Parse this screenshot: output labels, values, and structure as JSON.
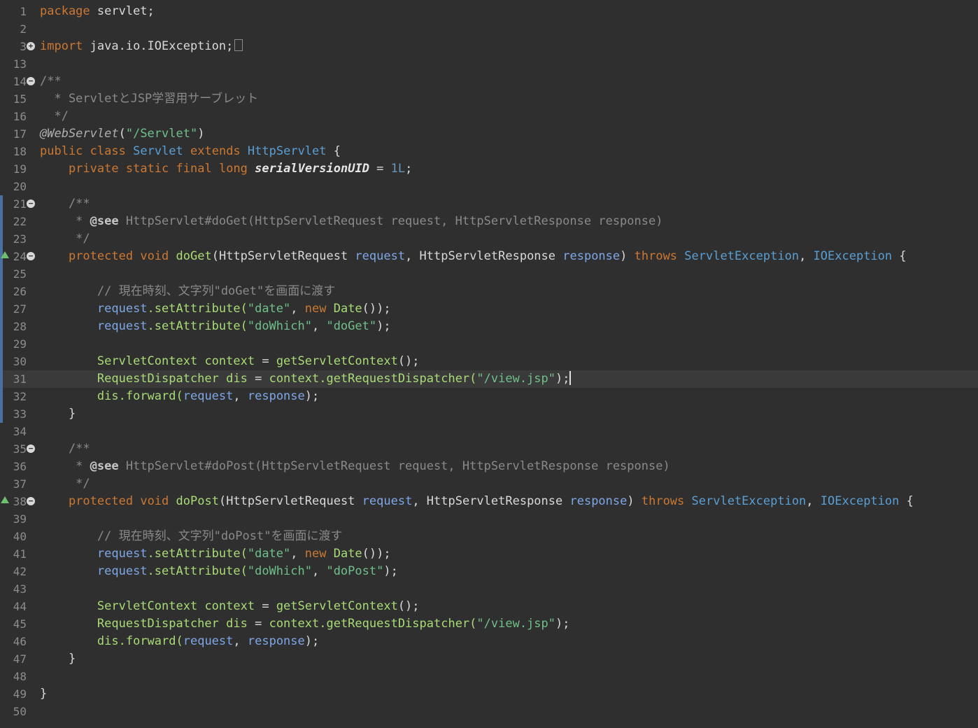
{
  "editor": {
    "language": "java",
    "current_line": 31,
    "lines": [
      {
        "n": "1",
        "marker": "",
        "tokens": [
          {
            "t": "package",
            "c": "kw"
          },
          {
            "t": " servlet;",
            "c": "plain"
          }
        ]
      },
      {
        "n": "2",
        "marker": "",
        "tokens": []
      },
      {
        "n": "3",
        "marker": "expand",
        "tokens": [
          {
            "t": "import",
            "c": "kw"
          },
          {
            "t": " java.io.IOException;",
            "c": "plain"
          }
        ],
        "collapsed": true
      },
      {
        "n": "13",
        "marker": "",
        "tokens": []
      },
      {
        "n": "14",
        "marker": "collapse",
        "tokens": [
          {
            "t": "/**",
            "c": "cmt"
          }
        ]
      },
      {
        "n": "15",
        "marker": "",
        "tokens": [
          {
            "t": "  * ServletとJSP学習用サーブレット",
            "c": "cmt"
          }
        ]
      },
      {
        "n": "16",
        "marker": "",
        "tokens": [
          {
            "t": "  */",
            "c": "cmt"
          }
        ]
      },
      {
        "n": "17",
        "marker": "",
        "tokens": [
          {
            "t": "@WebServlet",
            "c": "anno"
          },
          {
            "t": "(",
            "c": "plain"
          },
          {
            "t": "\"/Servlet\"",
            "c": "str"
          },
          {
            "t": ")",
            "c": "plain"
          }
        ]
      },
      {
        "n": "18",
        "marker": "",
        "tokens": [
          {
            "t": "public",
            "c": "kw"
          },
          {
            "t": " ",
            "c": "plain"
          },
          {
            "t": "class",
            "c": "kw"
          },
          {
            "t": " ",
            "c": "plain"
          },
          {
            "t": "Servlet",
            "c": "cls"
          },
          {
            "t": " ",
            "c": "plain"
          },
          {
            "t": "extends",
            "c": "kw"
          },
          {
            "t": " ",
            "c": "plain"
          },
          {
            "t": "HttpServlet",
            "c": "cls"
          },
          {
            "t": " {",
            "c": "plain"
          }
        ]
      },
      {
        "n": "19",
        "marker": "",
        "tokens": [
          {
            "t": "    ",
            "c": "plain"
          },
          {
            "t": "private",
            "c": "kw"
          },
          {
            "t": " ",
            "c": "plain"
          },
          {
            "t": "static",
            "c": "kw"
          },
          {
            "t": " ",
            "c": "plain"
          },
          {
            "t": "final",
            "c": "kw"
          },
          {
            "t": " ",
            "c": "plain"
          },
          {
            "t": "long",
            "c": "kw"
          },
          {
            "t": " ",
            "c": "plain"
          },
          {
            "t": "serialVersionUID",
            "c": "fieldname"
          },
          {
            "t": " = ",
            "c": "plain"
          },
          {
            "t": "1L",
            "c": "num"
          },
          {
            "t": ";",
            "c": "plain"
          }
        ]
      },
      {
        "n": "20",
        "marker": "",
        "tokens": []
      },
      {
        "n": "21",
        "marker": "collapse",
        "changed": true,
        "tokens": [
          {
            "t": "    /**",
            "c": "cmt"
          }
        ]
      },
      {
        "n": "22",
        "marker": "",
        "changed": true,
        "tokens": [
          {
            "t": "     * ",
            "c": "cmt"
          },
          {
            "t": "@see",
            "c": "tag"
          },
          {
            "t": " HttpServlet#doGet(HttpServletRequest request, HttpServletResponse response)",
            "c": "cmt"
          }
        ]
      },
      {
        "n": "23",
        "marker": "",
        "changed": true,
        "tokens": [
          {
            "t": "     */",
            "c": "cmt"
          }
        ]
      },
      {
        "n": "24",
        "marker": "collapse",
        "override": true,
        "changed": true,
        "tokens": [
          {
            "t": "    ",
            "c": "plain"
          },
          {
            "t": "protected",
            "c": "kw"
          },
          {
            "t": " ",
            "c": "plain"
          },
          {
            "t": "void",
            "c": "kw"
          },
          {
            "t": " ",
            "c": "plain"
          },
          {
            "t": "doGet",
            "c": "fld"
          },
          {
            "t": "(HttpServletRequest ",
            "c": "plain"
          },
          {
            "t": "request",
            "c": "var"
          },
          {
            "t": ", HttpServletResponse ",
            "c": "plain"
          },
          {
            "t": "response",
            "c": "var"
          },
          {
            "t": ") ",
            "c": "plain"
          },
          {
            "t": "throws",
            "c": "kw"
          },
          {
            "t": " ",
            "c": "plain"
          },
          {
            "t": "ServletException",
            "c": "cls"
          },
          {
            "t": ", ",
            "c": "plain"
          },
          {
            "t": "IOException",
            "c": "cls"
          },
          {
            "t": " {",
            "c": "plain"
          }
        ]
      },
      {
        "n": "25",
        "marker": "",
        "changed": true,
        "tokens": []
      },
      {
        "n": "26",
        "marker": "",
        "changed": true,
        "tokens": [
          {
            "t": "        // 現在時刻、文字列\"doGet\"を画面に渡す",
            "c": "cmt"
          }
        ]
      },
      {
        "n": "27",
        "marker": "",
        "changed": true,
        "tokens": [
          {
            "t": "        ",
            "c": "plain"
          },
          {
            "t": "request",
            "c": "var"
          },
          {
            "t": ".setAttribute(",
            "c": "fld"
          },
          {
            "t": "\"date\"",
            "c": "str"
          },
          {
            "t": ", ",
            "c": "plain"
          },
          {
            "t": "new",
            "c": "kw"
          },
          {
            "t": " ",
            "c": "plain"
          },
          {
            "t": "Date",
            "c": "fld"
          },
          {
            "t": "());",
            "c": "plain"
          }
        ]
      },
      {
        "n": "28",
        "marker": "",
        "changed": true,
        "tokens": [
          {
            "t": "        ",
            "c": "plain"
          },
          {
            "t": "request",
            "c": "var"
          },
          {
            "t": ".setAttribute(",
            "c": "fld"
          },
          {
            "t": "\"doWhich\"",
            "c": "str"
          },
          {
            "t": ", ",
            "c": "plain"
          },
          {
            "t": "\"doGet\"",
            "c": "str"
          },
          {
            "t": ");",
            "c": "plain"
          }
        ]
      },
      {
        "n": "29",
        "marker": "",
        "changed": true,
        "tokens": []
      },
      {
        "n": "30",
        "marker": "",
        "changed": true,
        "tokens": [
          {
            "t": "        ",
            "c": "plain"
          },
          {
            "t": "ServletContext",
            "c": "fld"
          },
          {
            "t": " ",
            "c": "plain"
          },
          {
            "t": "context",
            "c": "fld"
          },
          {
            "t": " = ",
            "c": "plain"
          },
          {
            "t": "getServletContext",
            "c": "fld"
          },
          {
            "t": "();",
            "c": "plain"
          }
        ]
      },
      {
        "n": "31",
        "marker": "",
        "changed": true,
        "tokens": [
          {
            "t": "        ",
            "c": "plain"
          },
          {
            "t": "RequestDispatcher",
            "c": "fld"
          },
          {
            "t": " ",
            "c": "plain"
          },
          {
            "t": "dis",
            "c": "fld"
          },
          {
            "t": " = ",
            "c": "plain"
          },
          {
            "t": "context",
            "c": "fld"
          },
          {
            "t": ".getRequestDispatcher(",
            "c": "fld"
          },
          {
            "t": "\"/view.jsp\"",
            "c": "str"
          },
          {
            "t": ");",
            "c": "plain"
          }
        ],
        "caret": true
      },
      {
        "n": "32",
        "marker": "",
        "changed": true,
        "tokens": [
          {
            "t": "        ",
            "c": "plain"
          },
          {
            "t": "dis",
            "c": "fld"
          },
          {
            "t": ".forward(",
            "c": "fld"
          },
          {
            "t": "request",
            "c": "var"
          },
          {
            "t": ", ",
            "c": "plain"
          },
          {
            "t": "response",
            "c": "var"
          },
          {
            "t": ");",
            "c": "plain"
          }
        ]
      },
      {
        "n": "33",
        "marker": "",
        "changed": true,
        "tokens": [
          {
            "t": "    }",
            "c": "plain"
          }
        ]
      },
      {
        "n": "34",
        "marker": "",
        "tokens": []
      },
      {
        "n": "35",
        "marker": "collapse",
        "tokens": [
          {
            "t": "    /**",
            "c": "cmt"
          }
        ]
      },
      {
        "n": "36",
        "marker": "",
        "tokens": [
          {
            "t": "     * ",
            "c": "cmt"
          },
          {
            "t": "@see",
            "c": "tag"
          },
          {
            "t": " HttpServlet#doPost(HttpServletRequest request, HttpServletResponse response)",
            "c": "cmt"
          }
        ]
      },
      {
        "n": "37",
        "marker": "",
        "tokens": [
          {
            "t": "     */",
            "c": "cmt"
          }
        ]
      },
      {
        "n": "38",
        "marker": "collapse",
        "override": true,
        "tokens": [
          {
            "t": "    ",
            "c": "plain"
          },
          {
            "t": "protected",
            "c": "kw"
          },
          {
            "t": " ",
            "c": "plain"
          },
          {
            "t": "void",
            "c": "kw"
          },
          {
            "t": " ",
            "c": "plain"
          },
          {
            "t": "doPost",
            "c": "fld"
          },
          {
            "t": "(HttpServletRequest ",
            "c": "plain"
          },
          {
            "t": "request",
            "c": "var"
          },
          {
            "t": ", HttpServletResponse ",
            "c": "plain"
          },
          {
            "t": "response",
            "c": "var"
          },
          {
            "t": ") ",
            "c": "plain"
          },
          {
            "t": "throws",
            "c": "kw"
          },
          {
            "t": " ",
            "c": "plain"
          },
          {
            "t": "ServletException",
            "c": "cls"
          },
          {
            "t": ", ",
            "c": "plain"
          },
          {
            "t": "IOException",
            "c": "cls"
          },
          {
            "t": " {",
            "c": "plain"
          }
        ]
      },
      {
        "n": "39",
        "marker": "",
        "tokens": []
      },
      {
        "n": "40",
        "marker": "",
        "tokens": [
          {
            "t": "        // 現在時刻、文字列\"doPost\"を画面に渡す",
            "c": "cmt"
          }
        ]
      },
      {
        "n": "41",
        "marker": "",
        "tokens": [
          {
            "t": "        ",
            "c": "plain"
          },
          {
            "t": "request",
            "c": "var"
          },
          {
            "t": ".setAttribute(",
            "c": "fld"
          },
          {
            "t": "\"date\"",
            "c": "str"
          },
          {
            "t": ", ",
            "c": "plain"
          },
          {
            "t": "new",
            "c": "kw"
          },
          {
            "t": " ",
            "c": "plain"
          },
          {
            "t": "Date",
            "c": "fld"
          },
          {
            "t": "());",
            "c": "plain"
          }
        ]
      },
      {
        "n": "42",
        "marker": "",
        "tokens": [
          {
            "t": "        ",
            "c": "plain"
          },
          {
            "t": "request",
            "c": "var"
          },
          {
            "t": ".setAttribute(",
            "c": "fld"
          },
          {
            "t": "\"doWhich\"",
            "c": "str"
          },
          {
            "t": ", ",
            "c": "plain"
          },
          {
            "t": "\"doPost\"",
            "c": "str"
          },
          {
            "t": ");",
            "c": "plain"
          }
        ]
      },
      {
        "n": "43",
        "marker": "",
        "tokens": []
      },
      {
        "n": "44",
        "marker": "",
        "tokens": [
          {
            "t": "        ",
            "c": "plain"
          },
          {
            "t": "ServletContext",
            "c": "fld"
          },
          {
            "t": " ",
            "c": "plain"
          },
          {
            "t": "context",
            "c": "fld"
          },
          {
            "t": " = ",
            "c": "plain"
          },
          {
            "t": "getServletContext",
            "c": "fld"
          },
          {
            "t": "();",
            "c": "plain"
          }
        ]
      },
      {
        "n": "45",
        "marker": "",
        "tokens": [
          {
            "t": "        ",
            "c": "plain"
          },
          {
            "t": "RequestDispatcher",
            "c": "fld"
          },
          {
            "t": " ",
            "c": "plain"
          },
          {
            "t": "dis",
            "c": "fld"
          },
          {
            "t": " = ",
            "c": "plain"
          },
          {
            "t": "context",
            "c": "fld"
          },
          {
            "t": ".getRequestDispatcher(",
            "c": "fld"
          },
          {
            "t": "\"/view.jsp\"",
            "c": "str"
          },
          {
            "t": ");",
            "c": "plain"
          }
        ]
      },
      {
        "n": "46",
        "marker": "",
        "tokens": [
          {
            "t": "        ",
            "c": "plain"
          },
          {
            "t": "dis",
            "c": "fld"
          },
          {
            "t": ".forward(",
            "c": "fld"
          },
          {
            "t": "request",
            "c": "var"
          },
          {
            "t": ", ",
            "c": "plain"
          },
          {
            "t": "response",
            "c": "var"
          },
          {
            "t": ");",
            "c": "plain"
          }
        ]
      },
      {
        "n": "47",
        "marker": "",
        "tokens": [
          {
            "t": "    }",
            "c": "plain"
          }
        ]
      },
      {
        "n": "48",
        "marker": "",
        "tokens": []
      },
      {
        "n": "49",
        "marker": "",
        "tokens": [
          {
            "t": "}",
            "c": "plain"
          }
        ]
      },
      {
        "n": "50",
        "marker": "",
        "tokens": []
      }
    ]
  }
}
